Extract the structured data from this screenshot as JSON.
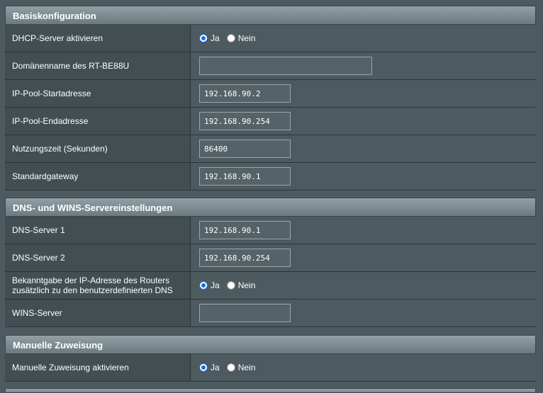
{
  "basic": {
    "title": "Basiskonfiguration",
    "rows": [
      {
        "label": "DHCP-Server aktivieren",
        "type": "radio",
        "yes": "Ja",
        "no": "Nein",
        "selected": "Ja"
      },
      {
        "label": "Domänenname des RT-BE88U",
        "type": "input",
        "value": ""
      },
      {
        "label": "IP-Pool-Startadresse",
        "type": "input",
        "value": "192.168.90.2"
      },
      {
        "label": "IP-Pool-Endadresse",
        "type": "input",
        "value": "192.168.90.254"
      },
      {
        "label": "Nutzungszeit (Sekunden)",
        "type": "input",
        "value": "86400"
      },
      {
        "label": "Standardgateway",
        "type": "input",
        "value": "192.168.90.1"
      }
    ]
  },
  "dns": {
    "title": "DNS- und WINS-Servereinstellungen",
    "rows": [
      {
        "label": "DNS-Server 1",
        "type": "input",
        "value": "192.168.90.1"
      },
      {
        "label": "DNS-Server 2",
        "type": "input",
        "value": "192.168.90.254"
      },
      {
        "label": "Bekanntgabe der IP-Adresse des Routers zusätzlich zu den benutzerdefinierten DNS",
        "type": "radio",
        "yes": "Ja",
        "no": "Nein",
        "selected": "Ja"
      },
      {
        "label": "WINS-Server",
        "type": "input",
        "value": ""
      }
    ]
  },
  "manual": {
    "title": "Manuelle Zuweisung",
    "rows": [
      {
        "label": "Manuelle Zuweisung aktivieren",
        "type": "radio",
        "yes": "Ja",
        "no": "Nein",
        "selected": "Ja"
      }
    ]
  },
  "colors": {
    "accent": "#1b6fd6",
    "background": "#4d5a5f",
    "header": "#7d8b90"
  }
}
